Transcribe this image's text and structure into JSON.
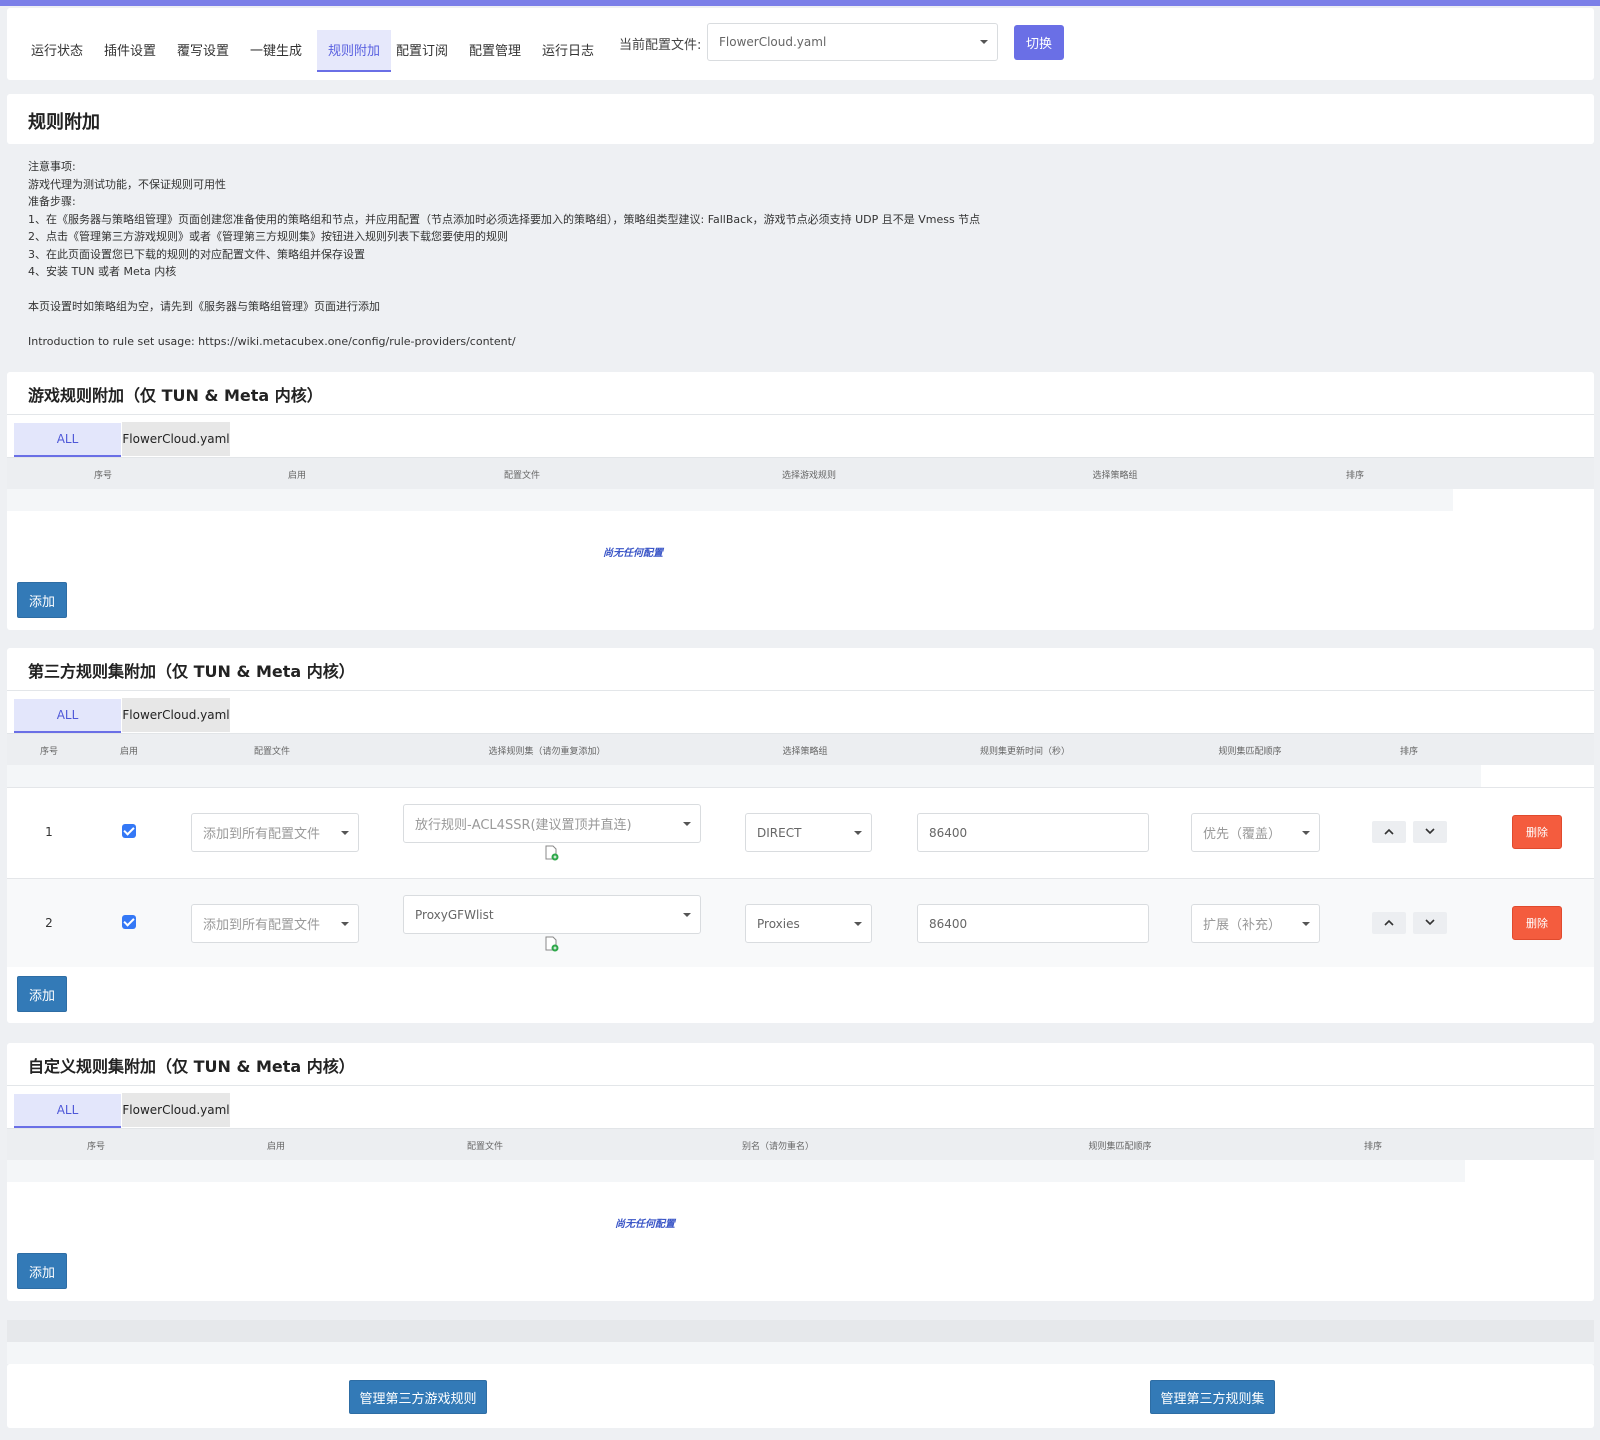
{
  "nav": {
    "items": [
      "运行状态",
      "插件设置",
      "覆写设置",
      "一键生成",
      "规则附加",
      "配置订阅",
      "配置管理",
      "运行日志"
    ],
    "active_index": 4,
    "current_label": "当前配置文件:",
    "current_value": "FlowerCloud.yaml",
    "switch_label": "切换"
  },
  "header": {
    "title": "规则附加",
    "notes": [
      "注意事项:",
      "游戏代理为测试功能，不保证规则可用性",
      "准备步骤:",
      "1、在《服务器与策略组管理》页面创建您准备使用的策略组和节点，并应用配置（节点添加时必须选择要加入的策略组），策略组类型建议: FallBack，游戏节点必须支持 UDP 且不是 Vmess 节点",
      "2、点击《管理第三方游戏规则》或者《管理第三方规则集》按钮进入规则列表下载您要使用的规则",
      "3、在此页面设置您已下载的规则的对应配置文件、策略组并保存设置",
      "4、安装 TUN 或者 Meta 内核",
      "",
      "本页设置时如策略组为空，请先到《服务器与策略组管理》页面进行添加",
      "",
      "Introduction to rule set usage: https://wiki.metacubex.one/config/rule-providers/content/"
    ]
  },
  "game_section": {
    "title": "游戏规则附加（仅 TUN & Meta 内核）",
    "tabs": [
      "ALL",
      "FlowerCloud.yaml"
    ],
    "columns": [
      "序号",
      "启用",
      "配置文件",
      "选择游戏规则",
      "选择策略组",
      "排序"
    ],
    "empty_text": "尚无任何配置",
    "add_label": "添加"
  },
  "ruleset_section": {
    "title": "第三方规则集附加（仅 TUN & Meta 内核）",
    "tabs": [
      "ALL",
      "FlowerCloud.yaml"
    ],
    "columns": [
      "序号",
      "启用",
      "配置文件",
      "选择规则集（请勿重复添加）",
      "选择策略组",
      "规则集更新时间（秒）",
      "规则集匹配顺序",
      "排序"
    ],
    "rows": [
      {
        "index": "1",
        "enabled": true,
        "config": "添加到所有配置文件",
        "ruleset": "放行规则-ACL4SSR(建议置顶并直连)",
        "group": "DIRECT",
        "interval": "86400",
        "order": "优先（覆盖）",
        "delete_label": "删除"
      },
      {
        "index": "2",
        "enabled": true,
        "config": "添加到所有配置文件",
        "ruleset": "ProxyGFWlist",
        "group": "Proxies",
        "interval": "86400",
        "order": "扩展（补充）",
        "delete_label": "删除"
      }
    ],
    "add_label": "添加"
  },
  "custom_section": {
    "title": "自定义规则集附加（仅 TUN & Meta 内核）",
    "tabs": [
      "ALL",
      "FlowerCloud.yaml"
    ],
    "columns": [
      "序号",
      "启用",
      "配置文件",
      "别名（请勿重名）",
      "规则集匹配顺序",
      "排序"
    ],
    "empty_text": "尚无任何配置",
    "add_label": "添加"
  },
  "footer": {
    "manage_game_label": "管理第三方游戏规则",
    "manage_ruleset_label": "管理第三方规则集"
  },
  "colors": {
    "accent": "#6a6fe6",
    "primary_button": "#337ab7",
    "delete_button": "#f45c3e",
    "checkbox": "#3478f6"
  }
}
